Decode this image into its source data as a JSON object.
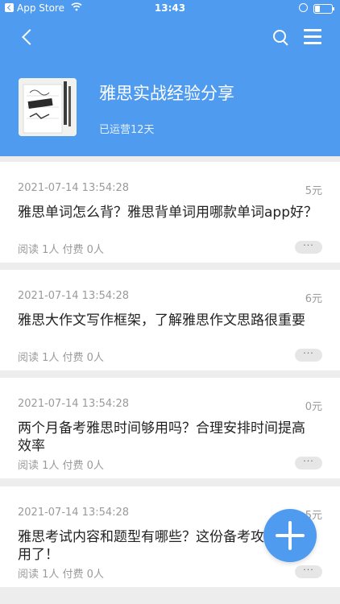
{
  "status_bar": {
    "carrier": "App Store",
    "time": "13:43"
  },
  "header": {
    "title": "雅思实战经验分享",
    "subtitle": "已运营12天",
    "accent_color": "#4f9bef"
  },
  "posts": [
    {
      "date": "2021-07-14 13:54:28",
      "price": "5元",
      "title": "雅思单词怎么背？雅思背单词用哪款单词app好？",
      "meta": "阅读 1人 付费 0人",
      "more": "···"
    },
    {
      "date": "2021-07-14 13:54:28",
      "price": "6元",
      "title": "雅思大作文写作框架，了解雅思作文思路很重要",
      "meta": "阅读 1人 付费 0人",
      "more": "···"
    },
    {
      "date": "2021-07-14 13:54:28",
      "price": "0元",
      "title": "两个月备考雅思时间够用吗？合理安排时间提高效率",
      "meta": "阅读 1人 付费 0人",
      "more": "···"
    },
    {
      "date": "2021-07-14 13:54:28",
      "price": "5元",
      "title": "雅思考试内容和题型有哪些？这份备考攻略太实用了！",
      "meta": "阅读 1人 付费 0人",
      "more": "···"
    }
  ],
  "icons": {
    "back": "chevron-left-icon",
    "search": "search-icon",
    "menu": "menu-icon",
    "fab": "plus-icon"
  }
}
